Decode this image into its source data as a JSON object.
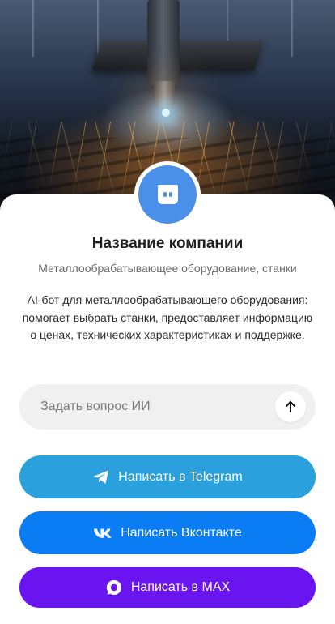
{
  "company": {
    "name": "Название компании",
    "category": "Металлообрабатывающее оборудование, станки",
    "description": "AI-бот для металлообрабатывающего оборудования: помогает выбрать станки, предоставляет информацию о ценах, технических характеристиках и поддержке."
  },
  "ask": {
    "placeholder": "Задать вопрос ИИ"
  },
  "buttons": {
    "telegram": "Написать в Telegram",
    "vk": "Написать Вконтакте",
    "max": "Написать в MAX"
  },
  "colors": {
    "avatar": "#4a8fe8",
    "telegram": "#2aa0dd",
    "vk": "#0a7df5",
    "max": "#6a14f0"
  },
  "icons": {
    "avatar": "chat-bot-icon",
    "send": "arrow-up-icon",
    "telegram": "telegram-icon",
    "vk": "vk-icon",
    "max": "max-icon"
  }
}
